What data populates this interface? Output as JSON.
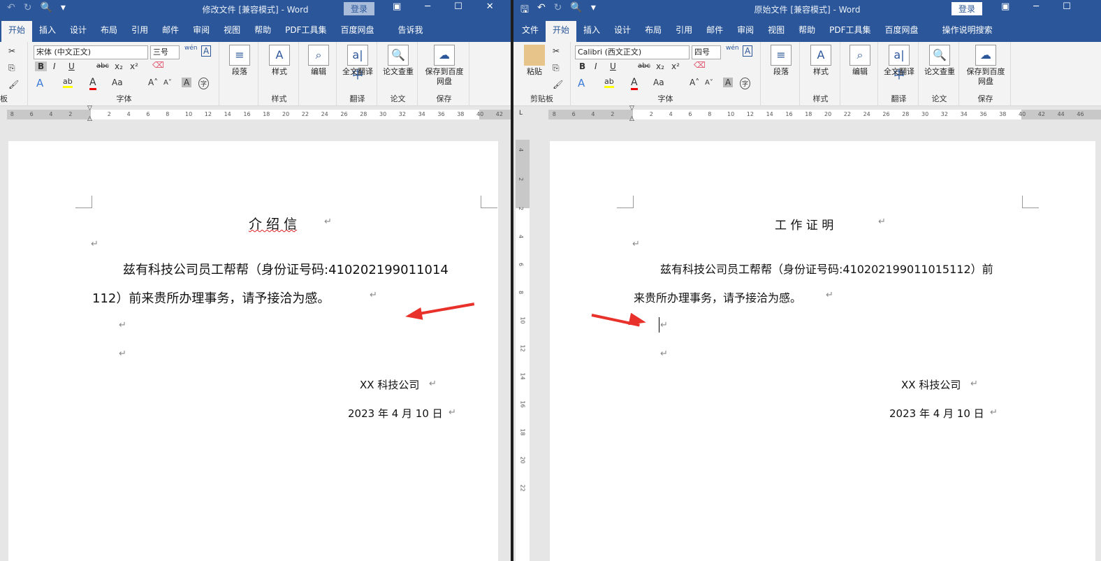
{
  "left": {
    "title": "修改文件 [兼容模式]  -  Word",
    "login": "登录",
    "tabs": [
      "开始",
      "插入",
      "设计",
      "布局",
      "引用",
      "邮件",
      "审阅",
      "视图",
      "帮助",
      "PDF工具集",
      "百度网盘",
      "告诉我"
    ],
    "font_name": "宋体 (中文正文)",
    "font_size": "三号",
    "groups": [
      "板",
      "字体",
      "段落",
      "样式",
      "样式",
      "编辑",
      "全文翻译",
      "翻译",
      "论文查重",
      "论文",
      "保存到百度网盘",
      "保存"
    ],
    "ruler": [
      "8",
      "6",
      "4",
      "2",
      "2",
      "4",
      "6",
      "8",
      "10",
      "12",
      "14",
      "16",
      "18",
      "20",
      "22",
      "24",
      "26",
      "28",
      "30",
      "32",
      "34",
      "36",
      "38",
      "40",
      "42"
    ],
    "doc": {
      "heading": "介  绍  信",
      "body1": "兹有科技公司员工帮帮（身份证号码:410202199011014",
      "body2": "112）前来贵所办理事务，请予接洽为感。",
      "company": "XX 科技公司",
      "date": "2023 年 4 月 10 日"
    }
  },
  "right": {
    "title": "原始文件 [兼容模式]  -  Word",
    "login": "登录",
    "tabs": [
      "文件",
      "开始",
      "插入",
      "设计",
      "布局",
      "引用",
      "邮件",
      "审阅",
      "视图",
      "帮助",
      "PDF工具集",
      "百度网盘",
      "操作说明搜索"
    ],
    "font_name": "Calibri (西文正文)",
    "font_size": "四号",
    "groups": [
      "粘贴",
      "剪贴板",
      "字体",
      "段落",
      "样式",
      "样式",
      "编辑",
      "全文翻译",
      "翻译",
      "论文查重",
      "论文",
      "保存到百度网盘",
      "保存"
    ],
    "ruler": [
      "8",
      "6",
      "4",
      "2",
      "2",
      "4",
      "6",
      "8",
      "10",
      "12",
      "14",
      "16",
      "18",
      "20",
      "22",
      "24",
      "26",
      "28",
      "30",
      "32",
      "34",
      "36",
      "38",
      "40",
      "42",
      "44",
      "46"
    ],
    "vruler": [
      "4",
      "2",
      "2",
      "4",
      "6",
      "8",
      "10",
      "12",
      "14",
      "16",
      "18",
      "20",
      "22"
    ],
    "doc": {
      "heading": "工   作   证   明",
      "body1": "兹有科技公司员工帮帮（身份证号码:410202199011015112）前",
      "body2": "来贵所办理事务，请予接洽为感。",
      "company": "XX 科技公司",
      "date": "2023 年 4 月 10 日"
    }
  },
  "annotation_color": "#e8312a"
}
